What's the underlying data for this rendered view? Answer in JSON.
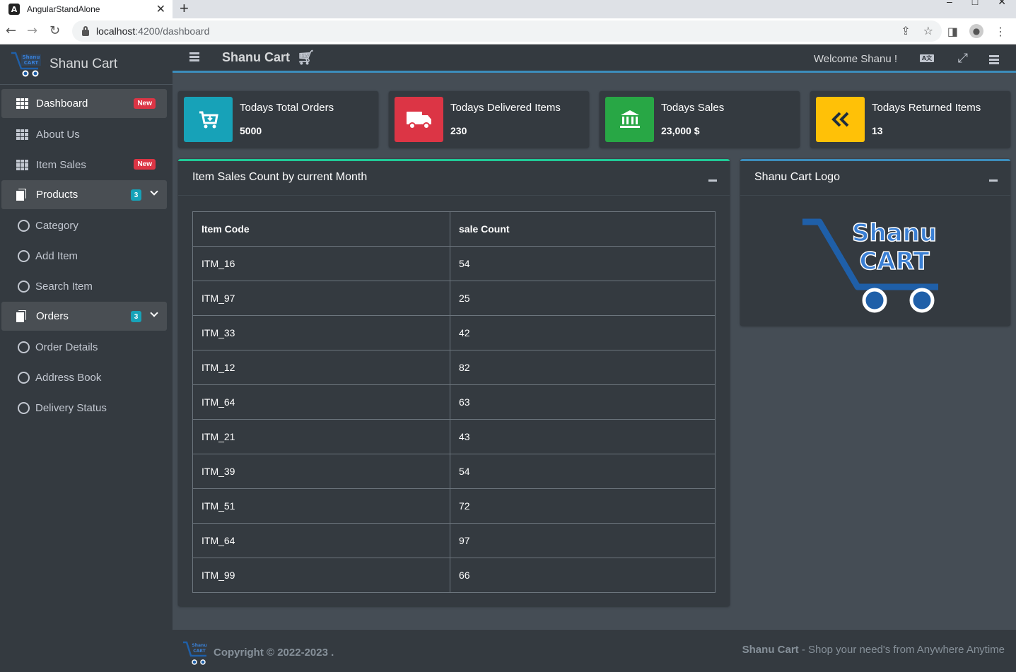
{
  "browser": {
    "tab_title": "AngularStandAlone",
    "url_host": "localhost",
    "url_path": ":4200/dashboard"
  },
  "sidebar": {
    "brand": "Shanu Cart",
    "items": [
      {
        "label": "Dashboard",
        "badge": "New",
        "icon": "grid-icon"
      },
      {
        "label": "About Us",
        "icon": "grid-icon"
      },
      {
        "label": "Item Sales",
        "badge": "New",
        "icon": "grid-icon"
      },
      {
        "label": "Products",
        "count": "3",
        "icon": "copy-icon"
      },
      {
        "label": "Category",
        "icon": "circle-icon"
      },
      {
        "label": "Add Item",
        "icon": "circle-icon"
      },
      {
        "label": "Search Item",
        "icon": "circle-icon"
      },
      {
        "label": "Orders",
        "count": "3",
        "icon": "copy-icon"
      },
      {
        "label": "Order Details",
        "icon": "circle-icon"
      },
      {
        "label": "Address Book",
        "icon": "circle-icon"
      },
      {
        "label": "Delivery Status",
        "icon": "circle-icon"
      }
    ]
  },
  "navbar": {
    "title": "Shanu Cart",
    "welcome": "Welcome Shanu !"
  },
  "info_boxes": [
    {
      "label": "Todays Total Orders",
      "value": "5000",
      "color": "#17a2b8",
      "icon": "cart-download-icon"
    },
    {
      "label": "Todays Delivered Items",
      "value": "230",
      "color": "#dc3545",
      "icon": "truck-icon"
    },
    {
      "label": "Todays Sales",
      "value": "23,000 $",
      "color": "#28a745",
      "icon": "bank-icon"
    },
    {
      "label": "Todays Returned Items",
      "value": "13",
      "color": "#ffc107",
      "icon": "double-left-icon"
    }
  ],
  "sales_card": {
    "title": "Item Sales Count by current Month",
    "columns": [
      "Item Code",
      "sale Count"
    ],
    "rows": [
      [
        "ITM_16",
        "54"
      ],
      [
        "ITM_97",
        "25"
      ],
      [
        "ITM_33",
        "42"
      ],
      [
        "ITM_12",
        "82"
      ],
      [
        "ITM_64",
        "63"
      ],
      [
        "ITM_21",
        "43"
      ],
      [
        "ITM_39",
        "54"
      ],
      [
        "ITM_51",
        "72"
      ],
      [
        "ITM_64",
        "97"
      ],
      [
        "ITM_99",
        "66"
      ]
    ]
  },
  "logo_card": {
    "title": "Shanu Cart Logo",
    "logo_line1": "Shanu",
    "logo_line2": "CART"
  },
  "footer": {
    "copyright": "Copyright © 2022-2023 .",
    "brand": "Shanu Cart",
    "tagline": " - Shop your need's from Anywhere Anytime"
  }
}
